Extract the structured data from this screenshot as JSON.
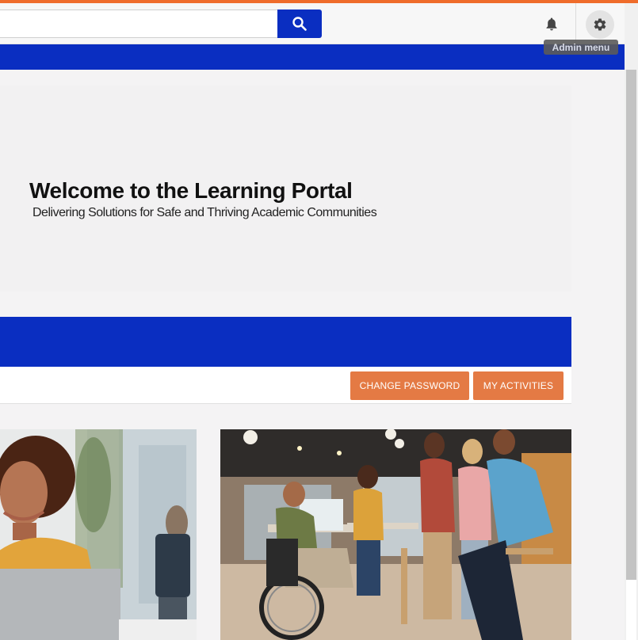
{
  "header": {
    "search": {
      "value": "",
      "placeholder": ""
    },
    "search_button_icon": "search-icon",
    "notifications_icon": "bell-icon",
    "admin_icon": "gear-icon",
    "admin_tooltip": "Admin menu"
  },
  "hero": {
    "title": "Welcome to the Learning Portal",
    "subtitle": "Delivering Solutions for Safe and Thriving Academic Communities"
  },
  "actions": {
    "change_password": "CHANGE PASSWORD",
    "my_activities": "MY ACTIVITIES"
  },
  "colors": {
    "accent_orange": "#ef6c2b",
    "brand_blue": "#0a2ec1",
    "button_orange": "#e47a44"
  }
}
